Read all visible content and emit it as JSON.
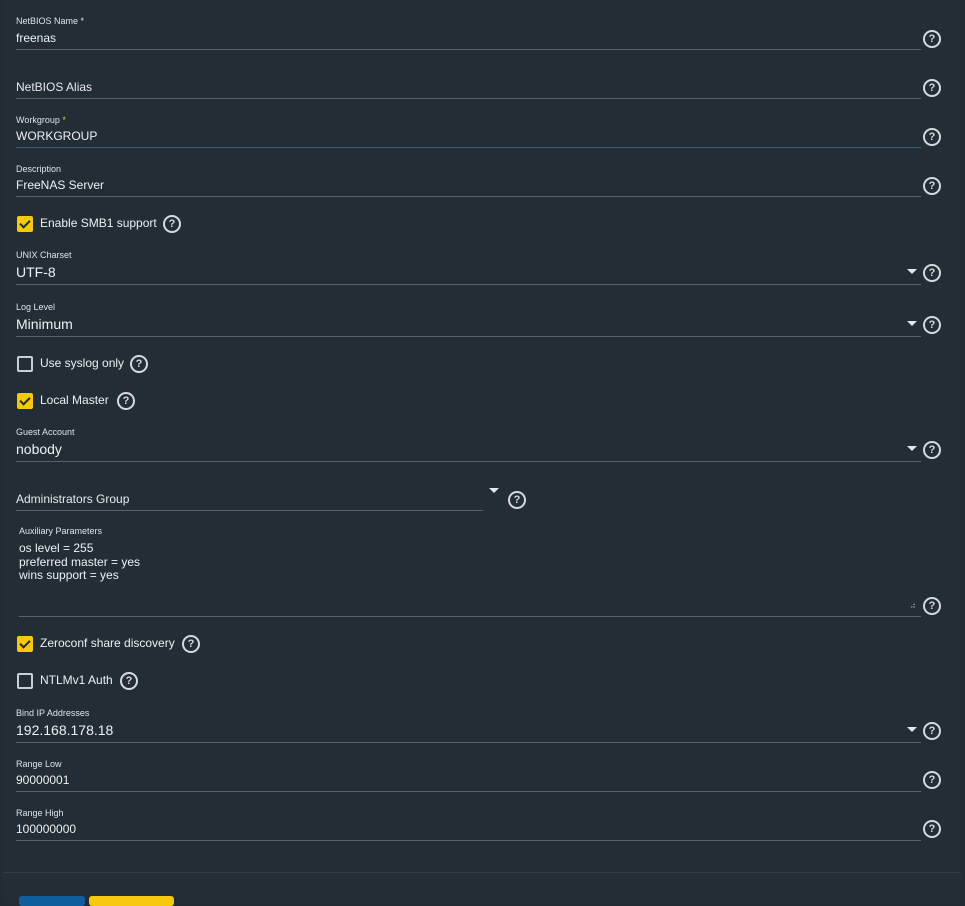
{
  "form": {
    "netbios_name": {
      "label": "NetBIOS Name *",
      "value": "freenas"
    },
    "netbios_alias": {
      "placeholder": "NetBIOS Alias"
    },
    "workgroup": {
      "label": "Workgroup",
      "required_mark": "*",
      "value": "WORKGROUP"
    },
    "description": {
      "label": "Description",
      "value": "FreeNAS Server"
    },
    "enable_smb1": {
      "label": "Enable SMB1 support",
      "checked": true
    },
    "unix_charset": {
      "label": "UNIX Charset",
      "value": "UTF-8"
    },
    "log_level": {
      "label": "Log Level",
      "value": "Minimum"
    },
    "use_syslog": {
      "label": "Use syslog only",
      "checked": false
    },
    "local_master": {
      "label": "Local Master",
      "checked": true
    },
    "guest_account": {
      "label": "Guest Account",
      "value": "nobody"
    },
    "administrators_group": {
      "placeholder": "Administrators Group"
    },
    "auxiliary_parameters": {
      "label": "Auxiliary Parameters",
      "value": "os level = 255\npreferred master = yes\nwins support = yes"
    },
    "zeroconf": {
      "label": "Zeroconf share discovery",
      "checked": true
    },
    "ntlmv1_auth": {
      "label": "NTLMv1 Auth",
      "checked": false
    },
    "bind_ip": {
      "label": "Bind IP Addresses",
      "value": "192.168.178.18"
    },
    "range_low": {
      "label": "Range Low",
      "value": "90000001"
    },
    "range_high": {
      "label": "Range High",
      "value": "100000000"
    }
  },
  "icons": {
    "help": "help-circle-icon",
    "dropdown": "caret-down-icon",
    "resize": "resize-grip-icon"
  },
  "help_glyph": "?",
  "colors": {
    "background": "#232d36",
    "accent": "#f6c90e",
    "primary_button": "#0e5e9e",
    "underline": "#55616c"
  }
}
